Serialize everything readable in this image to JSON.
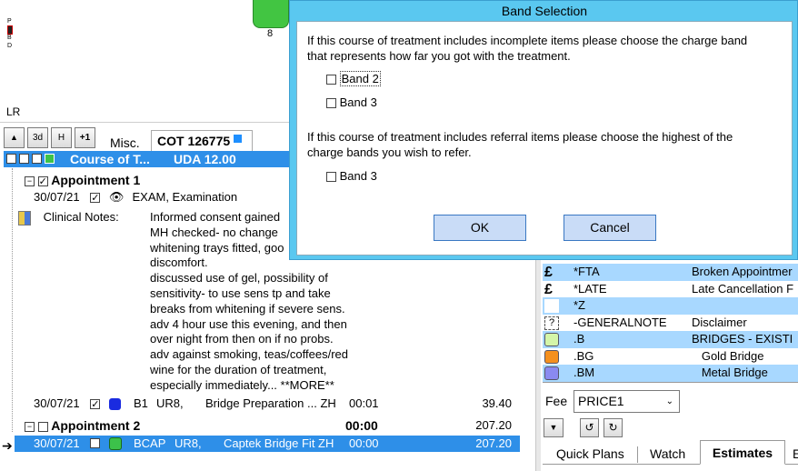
{
  "top": {
    "tooth_number": "8",
    "lr_label": "LR",
    "side_letters": [
      "P",
      "B",
      "D"
    ]
  },
  "toolbar": {
    "up_btn": "▲",
    "btn_3d": "3d",
    "btn_h": "H",
    "btn_plus1": "+1",
    "tab_misc": "Misc.",
    "tab_cot": "COT 126775"
  },
  "course": {
    "title": "Course of T...",
    "uda": "UDA 12.00"
  },
  "appointment1": {
    "label": "Appointment 1",
    "items": [
      {
        "date": "30/07/21",
        "text": "EXAM, Examination"
      }
    ],
    "notes_label": "Clinical Notes:",
    "notes": [
      "Informed consent gained",
      "MH checked- no change",
      "whitening trays fitted, goo",
      "discomfort.",
      "discussed use of gel, possibility of",
      "sensitivity- to use sens tp and take",
      "breaks from whitening if severe sens.",
      "adv 4 hour use this evening, and then",
      "over night from then on if no probs.",
      "adv against smoking, teas/coffees/red",
      "wine for the duration of treatment,",
      "especially immediately...   **MORE**"
    ],
    "bridge_row": {
      "date": "30/07/21",
      "code": "B1",
      "tooth": "UR8,",
      "desc": "Bridge Preparation ... ZH",
      "time": "00:01",
      "price": "39.40"
    }
  },
  "appointment2": {
    "label": "Appointment 2",
    "time": "00:00",
    "price": "207.20",
    "row": {
      "date": "30/07/21",
      "code": "BCAP",
      "tooth": "UR8,",
      "desc": "Captek Bridge Fit ZH",
      "time": "00:00",
      "price": "207.20"
    }
  },
  "dialog": {
    "title": "Band Selection",
    "text1_line1": "If this course of treatment includes incomplete items please choose the charge band",
    "text1_line2": "that represents how far you got with the treatment.",
    "band2": "Band 2",
    "band3a": "Band 3",
    "text2_line1": "If this course of treatment includes referral items please choose the highest of the",
    "text2_line2": "charge bands you wish to refer.",
    "band3b": "Band 3",
    "ok": "OK",
    "cancel": "Cancel"
  },
  "codes": [
    {
      "code": "*FTA",
      "desc": "Broken Appointmer",
      "icon": "pound-icon",
      "bg": "#a8d8ff"
    },
    {
      "code": "*LATE",
      "desc": "Late Cancellation F",
      "icon": "pound-icon",
      "bg": "#ffffff"
    },
    {
      "code": "*Z",
      "desc": "",
      "icon": "blank-icon",
      "bg": "#a8d8ff"
    },
    {
      "code": "-GENERALNOTE",
      "desc": "Disclaimer",
      "icon": "question-icon",
      "bg": "#ffffff"
    },
    {
      "code": ".B",
      "desc": "BRIDGES - EXISTI",
      "icon": "green-swatch-icon",
      "bg": "#a8d8ff"
    },
    {
      "code": ".BG",
      "desc": "   Gold Bridge",
      "icon": "orange-swatch-icon",
      "bg": "#ffffff"
    },
    {
      "code": ".BM",
      "desc": "   Metal Bridge",
      "icon": "purple-swatch-icon",
      "bg": "#a8d8ff"
    }
  ],
  "fee": {
    "label": "Fee",
    "value": "PRICE1"
  },
  "bottom_tabs": {
    "quick_plans": "Quick Plans",
    "watch": "Watch",
    "estimates": "Estimates",
    "more": "E"
  },
  "colors": {
    "highlight": "#2e8fe8",
    "light_row": "#a8d8ff",
    "dialog_frame": "#5ac8f0",
    "button": "#c9dcf7"
  }
}
